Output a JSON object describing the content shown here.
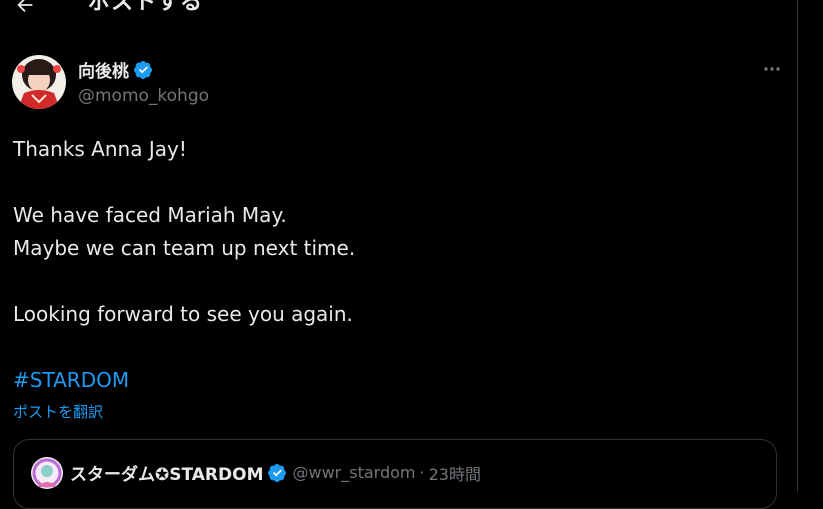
{
  "header": {
    "title": "ポストする"
  },
  "author": {
    "display_name": "向後桃",
    "handle": "@momo_kohgo",
    "verified": true
  },
  "tweet": {
    "lines": [
      "Thanks Anna Jay!",
      "",
      "We have faced Mariah May.",
      "Maybe we can team up next time.",
      "",
      "Looking forward to see you again.",
      ""
    ],
    "hashtag": "#STARDOM"
  },
  "translate_label": "ポストを翻訳",
  "quote": {
    "display_name": "スターダム✪STARDOM",
    "handle": "@wwr_stardom",
    "separator": "·",
    "time": "23時間",
    "verified": true
  },
  "colors": {
    "background": "#000000",
    "text": "#e7e9ea",
    "secondary": "#71767b",
    "accent": "#1d9bf0",
    "border": "#2f3336"
  },
  "icons": {
    "back": "arrow-left-icon",
    "verified": "verified-badge-icon",
    "more": "more-horizontal-icon"
  }
}
